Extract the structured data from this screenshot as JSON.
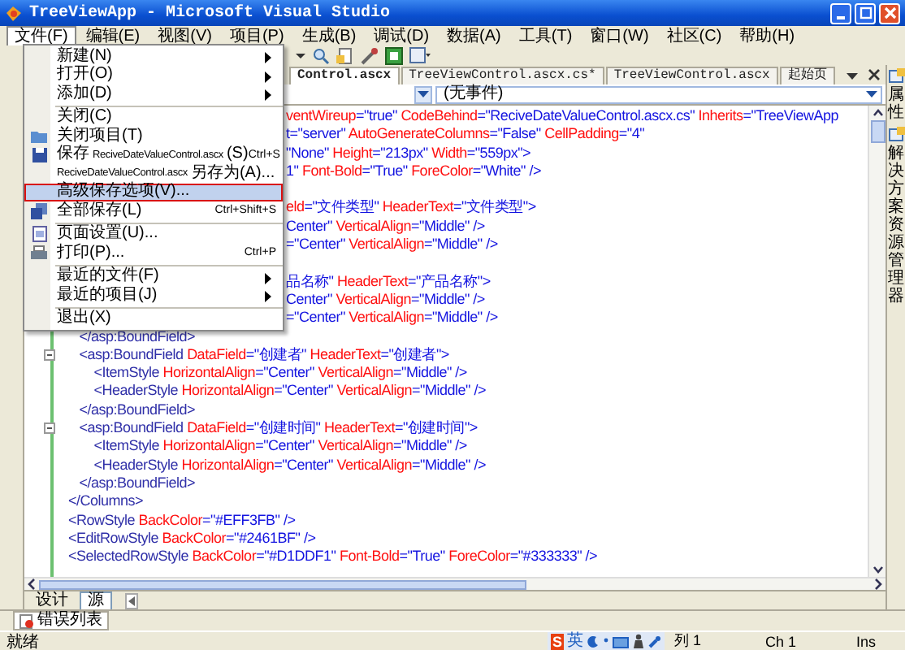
{
  "window": {
    "title": "TreeViewApp - Microsoft Visual Studio"
  },
  "menubar": [
    {
      "label": "文件(F)",
      "selected": true
    },
    {
      "label": "编辑(E)",
      "selected": false
    },
    {
      "label": "视图(V)",
      "selected": false
    },
    {
      "label": "项目(P)",
      "selected": false
    },
    {
      "label": "生成(B)",
      "selected": false
    },
    {
      "label": "调试(D)",
      "selected": false
    },
    {
      "label": "数据(A)",
      "selected": false
    },
    {
      "label": "工具(T)",
      "selected": false
    },
    {
      "label": "窗口(W)",
      "selected": false
    },
    {
      "label": "社区(C)",
      "selected": false
    },
    {
      "label": "帮助(H)",
      "selected": false
    }
  ],
  "file_menu": [
    {
      "parts": [
        {
          "kind": "text",
          "text": "新建(N)"
        }
      ],
      "submenu": true,
      "selected": false
    },
    {
      "parts": [
        {
          "kind": "text",
          "text": "打开(O)"
        }
      ],
      "submenu": true,
      "selected": false
    },
    {
      "parts": [
        {
          "kind": "text",
          "text": "添加(D)"
        }
      ],
      "submenu": true,
      "selected": false,
      "separator_after": true
    },
    {
      "parts": [
        {
          "kind": "text",
          "text": "关闭(C)"
        }
      ],
      "selected": false
    },
    {
      "parts": [
        {
          "kind": "text",
          "text": "关闭项目(T)"
        }
      ],
      "selected": false
    },
    {
      "parts": [
        {
          "kind": "text",
          "text": "保存"
        },
        {
          "kind": "file",
          "text": "ReciveDateValueControl.ascx"
        },
        {
          "kind": "text",
          "text": "(S)"
        }
      ],
      "shortcut": "Ctrl+S",
      "selected": false
    },
    {
      "parts": [
        {
          "kind": "file",
          "text": "ReciveDateValueControl.ascx"
        },
        {
          "kind": "text",
          "text": "另存为(A)..."
        }
      ],
      "selected": false
    },
    {
      "parts": [
        {
          "kind": "text",
          "text": "高级保存选项(V)..."
        }
      ],
      "selected": true
    },
    {
      "parts": [
        {
          "kind": "text",
          "text": "全部保存(L)"
        }
      ],
      "shortcut": "Ctrl+Shift+S",
      "selected": false,
      "separator_after": true
    },
    {
      "parts": [
        {
          "kind": "text",
          "text": "页面设置(U)..."
        }
      ],
      "selected": false
    },
    {
      "parts": [
        {
          "kind": "text",
          "text": "打印(P)..."
        }
      ],
      "shortcut": "Ctrl+P",
      "selected": false,
      "separator_after": true
    },
    {
      "parts": [
        {
          "kind": "text",
          "text": "最近的文件(F)"
        }
      ],
      "submenu": true,
      "selected": false
    },
    {
      "parts": [
        {
          "kind": "text",
          "text": "最近的项目(J)"
        }
      ],
      "submenu": true,
      "selected": false,
      "separator_after": true
    },
    {
      "parts": [
        {
          "kind": "text",
          "text": "退出(X)"
        }
      ],
      "selected": false
    }
  ],
  "doc_tabs": [
    {
      "label": "Control.ascx",
      "selected": true
    },
    {
      "label": "TreeViewControl.ascx.cs*",
      "selected": false
    },
    {
      "label": "TreeViewControl.ascx",
      "selected": false
    },
    {
      "label": "起始页",
      "selected": false
    }
  ],
  "event_dropdown": {
    "value": "(无事件)"
  },
  "code_lines": [
    {
      "kind": "code",
      "clipped": true,
      "segs": [
        {
          "kind": "attr",
          "text": "ventWireup"
        },
        {
          "kind": "value",
          "text": "=\"true\" "
        },
        {
          "kind": "attr",
          "text": "CodeBehind"
        },
        {
          "kind": "value",
          "text": "=\"ReciveDateValueControl.ascx.cs\" "
        },
        {
          "kind": "attr",
          "text": "Inherits"
        },
        {
          "kind": "value",
          "text": "=\"TreeViewApp"
        }
      ]
    },
    {
      "kind": "code",
      "clipped": true,
      "segs": [
        {
          "kind": "value",
          "text": "t=\"server\" "
        },
        {
          "kind": "attr",
          "text": "AutoGenerateColumns"
        },
        {
          "kind": "value",
          "text": "=\"False\" "
        },
        {
          "kind": "attr",
          "text": "CellPadding"
        },
        {
          "kind": "value",
          "text": "=\"4\""
        }
      ]
    },
    {
      "kind": "code",
      "clipped": true,
      "segs": [
        {
          "kind": "value",
          "text": "\"None\" "
        },
        {
          "kind": "attr",
          "text": "Height"
        },
        {
          "kind": "value",
          "text": "=\"213px\" "
        },
        {
          "kind": "attr",
          "text": "Width"
        },
        {
          "kind": "value",
          "text": "=\"559px\">"
        }
      ]
    },
    {
      "kind": "code",
      "clipped": true,
      "segs": [
        {
          "kind": "value",
          "text": "1\" "
        },
        {
          "kind": "attr",
          "text": "Font-Bold"
        },
        {
          "kind": "value",
          "text": "=\"True\" "
        },
        {
          "kind": "attr",
          "text": "ForeColor"
        },
        {
          "kind": "value",
          "text": "=\"White\" />"
        }
      ]
    },
    {
      "kind": "blank"
    },
    {
      "kind": "code",
      "clipped": true,
      "segs": [
        {
          "kind": "attr",
          "text": "eld"
        },
        {
          "kind": "value",
          "text": "=\"文件类型\" "
        },
        {
          "kind": "attr",
          "text": "HeaderText"
        },
        {
          "kind": "value",
          "text": "=\"文件类型\">"
        }
      ]
    },
    {
      "kind": "code",
      "clipped": true,
      "segs": [
        {
          "kind": "value",
          "text": "Center\" "
        },
        {
          "kind": "attr",
          "text": "VerticalAlign"
        },
        {
          "kind": "value",
          "text": "=\"Middle\" />"
        }
      ]
    },
    {
      "kind": "code",
      "clipped": true,
      "segs": [
        {
          "kind": "value",
          "text": "=\"Center\" "
        },
        {
          "kind": "attr",
          "text": "VerticalAlign"
        },
        {
          "kind": "value",
          "text": "=\"Middle\" />"
        }
      ]
    },
    {
      "kind": "blank"
    },
    {
      "kind": "code",
      "clipped": true,
      "segs": [
        {
          "kind": "value",
          "text": "品名称\" "
        },
        {
          "kind": "attr",
          "text": "HeaderText"
        },
        {
          "kind": "value",
          "text": "=\"产品名称\">"
        }
      ]
    },
    {
      "kind": "code",
      "clipped": true,
      "segs": [
        {
          "kind": "value",
          "text": "Center\" "
        },
        {
          "kind": "attr",
          "text": "VerticalAlign"
        },
        {
          "kind": "value",
          "text": "=\"Middle\" />"
        }
      ]
    },
    {
      "kind": "code",
      "clipped": true,
      "segs": [
        {
          "kind": "value",
          "text": "=\"Center\" "
        },
        {
          "kind": "attr",
          "text": "VerticalAlign"
        },
        {
          "kind": "value",
          "text": "=\"Middle\" />"
        }
      ]
    },
    {
      "kind": "code",
      "segs": [
        {
          "kind": "tag",
          "text": "   </asp:BoundField>"
        }
      ]
    },
    {
      "kind": "code",
      "fold": true,
      "segs": [
        {
          "kind": "tag",
          "text": "   <asp:BoundField "
        },
        {
          "kind": "attr",
          "text": "DataField"
        },
        {
          "kind": "value",
          "text": "=\"创建者\" "
        },
        {
          "kind": "attr",
          "text": "HeaderText"
        },
        {
          "kind": "value",
          "text": "=\"创建者\">"
        }
      ]
    },
    {
      "kind": "code",
      "segs": [
        {
          "kind": "tag",
          "text": "       <ItemStyle "
        },
        {
          "kind": "attr",
          "text": "HorizontalAlign"
        },
        {
          "kind": "value",
          "text": "=\"Center\" "
        },
        {
          "kind": "attr",
          "text": "VerticalAlign"
        },
        {
          "kind": "value",
          "text": "=\"Middle\" />"
        }
      ]
    },
    {
      "kind": "code",
      "segs": [
        {
          "kind": "tag",
          "text": "       <HeaderStyle "
        },
        {
          "kind": "attr",
          "text": "HorizontalAlign"
        },
        {
          "kind": "value",
          "text": "=\"Center\" "
        },
        {
          "kind": "attr",
          "text": "VerticalAlign"
        },
        {
          "kind": "value",
          "text": "=\"Middle\" />"
        }
      ]
    },
    {
      "kind": "code",
      "segs": [
        {
          "kind": "tag",
          "text": "   </asp:BoundField>"
        }
      ]
    },
    {
      "kind": "code",
      "fold": true,
      "segs": [
        {
          "kind": "tag",
          "text": "   <asp:BoundField "
        },
        {
          "kind": "attr",
          "text": "DataField"
        },
        {
          "kind": "value",
          "text": "=\"创建时间\" "
        },
        {
          "kind": "attr",
          "text": "HeaderText"
        },
        {
          "kind": "value",
          "text": "=\"创建时间\">"
        }
      ]
    },
    {
      "kind": "code",
      "segs": [
        {
          "kind": "tag",
          "text": "       <ItemStyle "
        },
        {
          "kind": "attr",
          "text": "HorizontalAlign"
        },
        {
          "kind": "value",
          "text": "=\"Center\" "
        },
        {
          "kind": "attr",
          "text": "VerticalAlign"
        },
        {
          "kind": "value",
          "text": "=\"Middle\" />"
        }
      ]
    },
    {
      "kind": "code",
      "segs": [
        {
          "kind": "tag",
          "text": "       <HeaderStyle "
        },
        {
          "kind": "attr",
          "text": "HorizontalAlign"
        },
        {
          "kind": "value",
          "text": "=\"Center\" "
        },
        {
          "kind": "attr",
          "text": "VerticalAlign"
        },
        {
          "kind": "value",
          "text": "=\"Middle\" />"
        }
      ]
    },
    {
      "kind": "code",
      "segs": [
        {
          "kind": "tag",
          "text": "   </asp:BoundField>"
        }
      ]
    },
    {
      "kind": "code",
      "segs": [
        {
          "kind": "tag",
          "text": "</Columns>"
        }
      ]
    },
    {
      "kind": "code",
      "segs": [
        {
          "kind": "tag",
          "text": "<RowStyle "
        },
        {
          "kind": "attr",
          "text": "BackColor"
        },
        {
          "kind": "value",
          "text": "=\"#EFF3FB\" />"
        }
      ]
    },
    {
      "kind": "code",
      "segs": [
        {
          "kind": "tag",
          "text": "<EditRowStyle "
        },
        {
          "kind": "attr",
          "text": "BackColor"
        },
        {
          "kind": "value",
          "text": "=\"#2461BF\" />"
        }
      ]
    },
    {
      "kind": "code",
      "segs": [
        {
          "kind": "tag",
          "text": "<SelectedRowStyle "
        },
        {
          "kind": "attr",
          "text": "BackColor"
        },
        {
          "kind": "value",
          "text": "=\"#D1DDF1\" "
        },
        {
          "kind": "attr",
          "text": "Font-Bold"
        },
        {
          "kind": "value",
          "text": "=\"True\" "
        },
        {
          "kind": "attr",
          "text": "ForeColor"
        },
        {
          "kind": "value",
          "text": "=\"#333333\" />"
        }
      ]
    }
  ],
  "view_tabs": [
    {
      "label": "设计",
      "selected": false
    },
    {
      "label": "源",
      "selected": true
    }
  ],
  "side_panel": [
    "属性",
    "解决方案资源管理器"
  ],
  "bottom_tab": {
    "label": "错误列表"
  },
  "status_bar": {
    "text": "就绪",
    "ime": [
      "S",
      "英"
    ],
    "line": "列 1",
    "col": "Ch 1",
    "mode": "Ins"
  }
}
